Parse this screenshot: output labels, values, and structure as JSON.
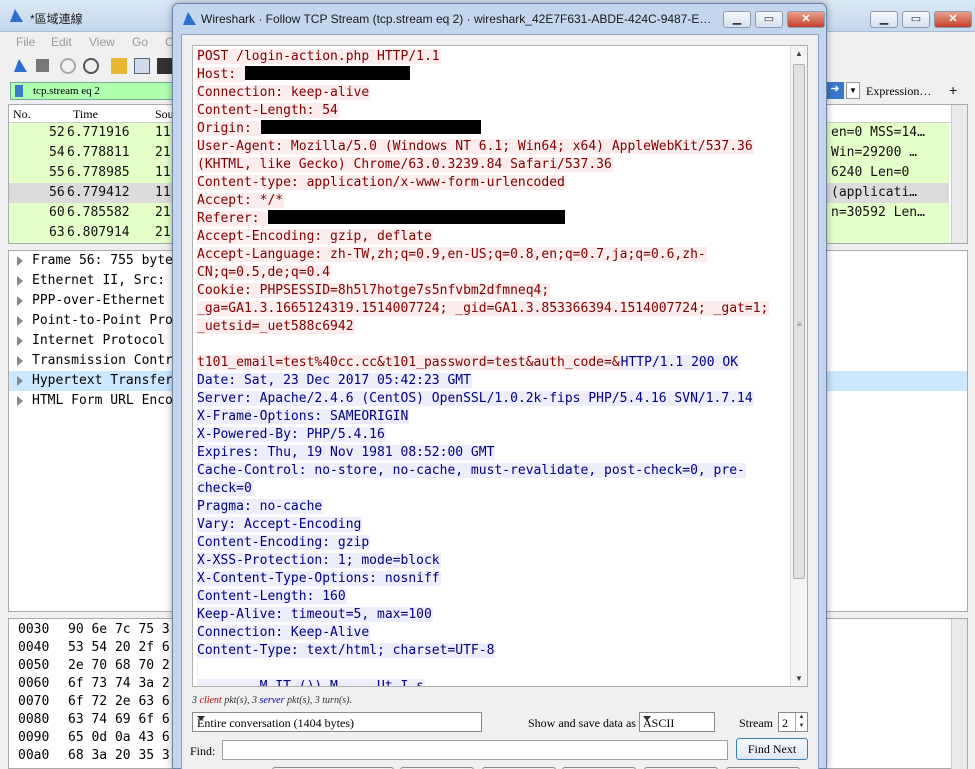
{
  "main_window": {
    "title": "*區域連線",
    "menu": [
      "File",
      "Edit",
      "View",
      "Go",
      "C"
    ],
    "filter": {
      "value": "tcp.stream eq 2",
      "color": "#afffaf"
    },
    "expression_label": "Expression…",
    "plus_label": "+",
    "columns": [
      "No.",
      "Time",
      "Sou"
    ],
    "packets": [
      {
        "no": "52",
        "time": "6.771916",
        "src": "11",
        "info": "en=0 MSS=14…"
      },
      {
        "no": "54",
        "time": "6.778811",
        "src": "21",
        "info": "Win=29200 …"
      },
      {
        "no": "55",
        "time": "6.778985",
        "src": "11",
        "info": "6240 Len=0"
      },
      {
        "no": "56",
        "time": "6.779412",
        "src": "11",
        "info": "(applicati…"
      },
      {
        "no": "60",
        "time": "6.785582",
        "src": "21",
        "info": "n=30592 Len…"
      },
      {
        "no": "63",
        "time": "6.807914",
        "src": "21",
        "info": ""
      }
    ],
    "tree": [
      "Frame 56: 755 byte",
      "Ethernet II, Src: ",
      "PPP-over-Ethernet ",
      "Point-to-Point Pro",
      "Internet Protocol ",
      "Transmission Contr",
      "Hypertext Transfer",
      "HTML Form URL Enco"
    ],
    "hex": [
      {
        "off": "0030",
        "bytes": "90 6e 7c 75 3"
      },
      {
        "off": "0040",
        "bytes": "53 54 20 2f 6"
      },
      {
        "off": "0050",
        "bytes": "2e 70 68 70 2"
      },
      {
        "off": "0060",
        "bytes": "6f 73 74 3a 2"
      },
      {
        "off": "0070",
        "bytes": "6f 72 2e 63 6"
      },
      {
        "off": "0080",
        "bytes": "63 74 69 6f 6"
      },
      {
        "off": "0090",
        "bytes": "65 0d 0a 43 6"
      },
      {
        "off": "00a0",
        "bytes": "68 3a 20 35 3"
      }
    ]
  },
  "dialog": {
    "title": "Wireshark · Follow TCP Stream (tcp.stream eq 2) · wireshark_42E7F631-ABDE-424C-9487-E…",
    "client_bg": "#fbeded",
    "client_fg": "#800000",
    "server_bg": "#ededfb",
    "server_fg": "#000080",
    "lines": [
      [
        {
          "t": "POST /login-action.php HTTP/1.1",
          "k": "c"
        }
      ],
      [
        {
          "t": "Host: ",
          "k": "c"
        },
        {
          "t": "",
          "k": "r",
          "w": 165
        }
      ],
      [
        {
          "t": "Connection: keep-alive",
          "k": "c"
        }
      ],
      [
        {
          "t": "Content-Length: 54",
          "k": "c"
        }
      ],
      [
        {
          "t": "Origin: ",
          "k": "c"
        },
        {
          "t": "",
          "k": "r",
          "w": 220
        }
      ],
      [
        {
          "t": "User-Agent: Mozilla/5.0 (Windows NT 6.1; Win64; x64) AppleWebKit/537.36",
          "k": "c"
        }
      ],
      [
        {
          "t": "(KHTML, like Gecko) Chrome/63.0.3239.84 Safari/537.36",
          "k": "c"
        }
      ],
      [
        {
          "t": "Content-type: application/x-www-form-urlencoded",
          "k": "c"
        }
      ],
      [
        {
          "t": "Accept: */*",
          "k": "c"
        }
      ],
      [
        {
          "t": "Referer: ",
          "k": "c"
        },
        {
          "t": "",
          "k": "r",
          "w": 297
        }
      ],
      [
        {
          "t": "Accept-Encoding: gzip, deflate",
          "k": "c"
        }
      ],
      [
        {
          "t": "Accept-Language: zh-TW,zh;q=0.9,en-US;q=0.8,en;q=0.7,ja;q=0.6,zh-",
          "k": "c"
        }
      ],
      [
        {
          "t": "CN;q=0.5,de;q=0.4",
          "k": "c"
        }
      ],
      [
        {
          "t": "Cookie: PHPSESSID=8h5l7hotge7s5nfvbm2dfmneq4;",
          "k": "c"
        }
      ],
      [
        {
          "t": "_ga=GA1.3.1665124319.1514007724; _gid=GA1.3.853366394.1514007724; _gat=1;",
          "k": "c"
        }
      ],
      [
        {
          "t": "_uetsid=_uet588c6942",
          "k": "c"
        }
      ],
      [
        {
          "t": "",
          "k": "c"
        }
      ],
      [
        {
          "t": "t101_email=test%40cc.cc&t101_password=test&auth_code=&",
          "k": "c"
        },
        {
          "t": "HTTP/1.1 200 OK",
          "k": "s"
        }
      ],
      [
        {
          "t": "Date: Sat, 23 Dec 2017 05:42:23 GMT",
          "k": "s"
        }
      ],
      [
        {
          "t": "Server: Apache/2.4.6 (CentOS) OpenSSL/1.0.2k-fips PHP/5.4.16 SVN/1.7.14",
          "k": "s"
        }
      ],
      [
        {
          "t": "X-Frame-Options: SAMEORIGIN",
          "k": "s"
        }
      ],
      [
        {
          "t": "X-Powered-By: PHP/5.4.16",
          "k": "s"
        }
      ],
      [
        {
          "t": "Expires: Thu, 19 Nov 1981 08:52:00 GMT",
          "k": "s"
        }
      ],
      [
        {
          "t": "Cache-Control: no-store, no-cache, must-revalidate, post-check=0, pre-",
          "k": "s"
        }
      ],
      [
        {
          "t": "check=0",
          "k": "s"
        }
      ],
      [
        {
          "t": "Pragma: no-cache",
          "k": "s"
        }
      ],
      [
        {
          "t": "Vary: Accept-Encoding",
          "k": "s"
        }
      ],
      [
        {
          "t": "Content-Encoding: gzip",
          "k": "s"
        }
      ],
      [
        {
          "t": "X-XSS-Protection: 1; mode=block",
          "k": "s"
        }
      ],
      [
        {
          "t": "X-Content-Type-Options: nosniff",
          "k": "s"
        }
      ],
      [
        {
          "t": "Content-Length: 160",
          "k": "s"
        }
      ],
      [
        {
          "t": "Keep-Alive: timeout=5, max=100",
          "k": "s"
        }
      ],
      [
        {
          "t": "Connection: Keep-Alive",
          "k": "s"
        }
      ],
      [
        {
          "t": "Content-Type: text/html; charset=UTF-8",
          "k": "s"
        }
      ],
      [
        {
          "t": "",
          "k": "s"
        }
      ],
      [
        {
          "t": "........M.IT.()).M.....Ut.I.s",
          "k": "s"
        }
      ]
    ],
    "stats": {
      "client_count": "3",
      "client_word": "client",
      "pkts1": "pkt(s), ",
      "server_count": "3",
      "server_word": "server",
      "pkts2": "pkt(s), 3 turn(s)."
    },
    "conversation": "Entire conversation (1404 bytes)",
    "show_save_label": "Show and save data as",
    "format": "ASCII",
    "stream_label": "Stream",
    "stream_value": "2",
    "find_label": "Find:",
    "find_value": "",
    "find_next": "Find Next"
  }
}
